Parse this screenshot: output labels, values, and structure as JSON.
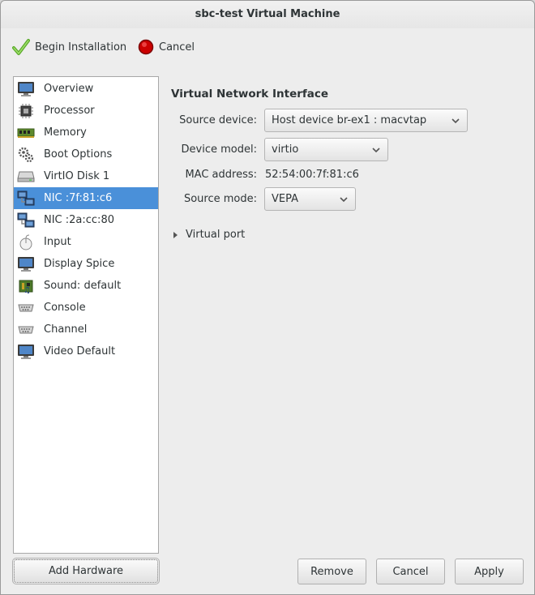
{
  "window": {
    "title": "sbc-test Virtual Machine"
  },
  "toolbar": {
    "begin_label": "Begin Installation",
    "cancel_label": "Cancel"
  },
  "sidebar": {
    "items": [
      {
        "label": "Overview",
        "icon": "monitor-icon"
      },
      {
        "label": "Processor",
        "icon": "cpu-icon"
      },
      {
        "label": "Memory",
        "icon": "memory-icon"
      },
      {
        "label": "Boot Options",
        "icon": "gears-icon"
      },
      {
        "label": "VirtIO Disk 1",
        "icon": "disk-icon"
      },
      {
        "label": "NIC :7f:81:c6",
        "icon": "network-icon",
        "selected": true
      },
      {
        "label": "NIC :2a:cc:80",
        "icon": "network-icon"
      },
      {
        "label": "Input",
        "icon": "mouse-icon"
      },
      {
        "label": "Display Spice",
        "icon": "monitor-icon"
      },
      {
        "label": "Sound: default",
        "icon": "sound-card-icon"
      },
      {
        "label": "Console",
        "icon": "serial-icon"
      },
      {
        "label": "Channel",
        "icon": "serial-icon"
      },
      {
        "label": "Video Default",
        "icon": "monitor-icon"
      }
    ],
    "add_hardware_label": "Add Hardware"
  },
  "detail": {
    "section_title": "Virtual Network Interface",
    "source_device_label": "Source device:",
    "source_device_value": "Host device br-ex1 : macvtap",
    "device_model_label": "Device model:",
    "device_model_value": "virtio",
    "mac_label": "MAC address:",
    "mac_value": "52:54:00:7f:81:c6",
    "source_mode_label": "Source mode:",
    "source_mode_value": "VEPA",
    "virtual_port_label": "Virtual port"
  },
  "footer": {
    "remove_label": "Remove",
    "cancel_label": "Cancel",
    "apply_label": "Apply"
  },
  "colors": {
    "selection": "#4a90d9",
    "window_bg": "#ededed"
  }
}
